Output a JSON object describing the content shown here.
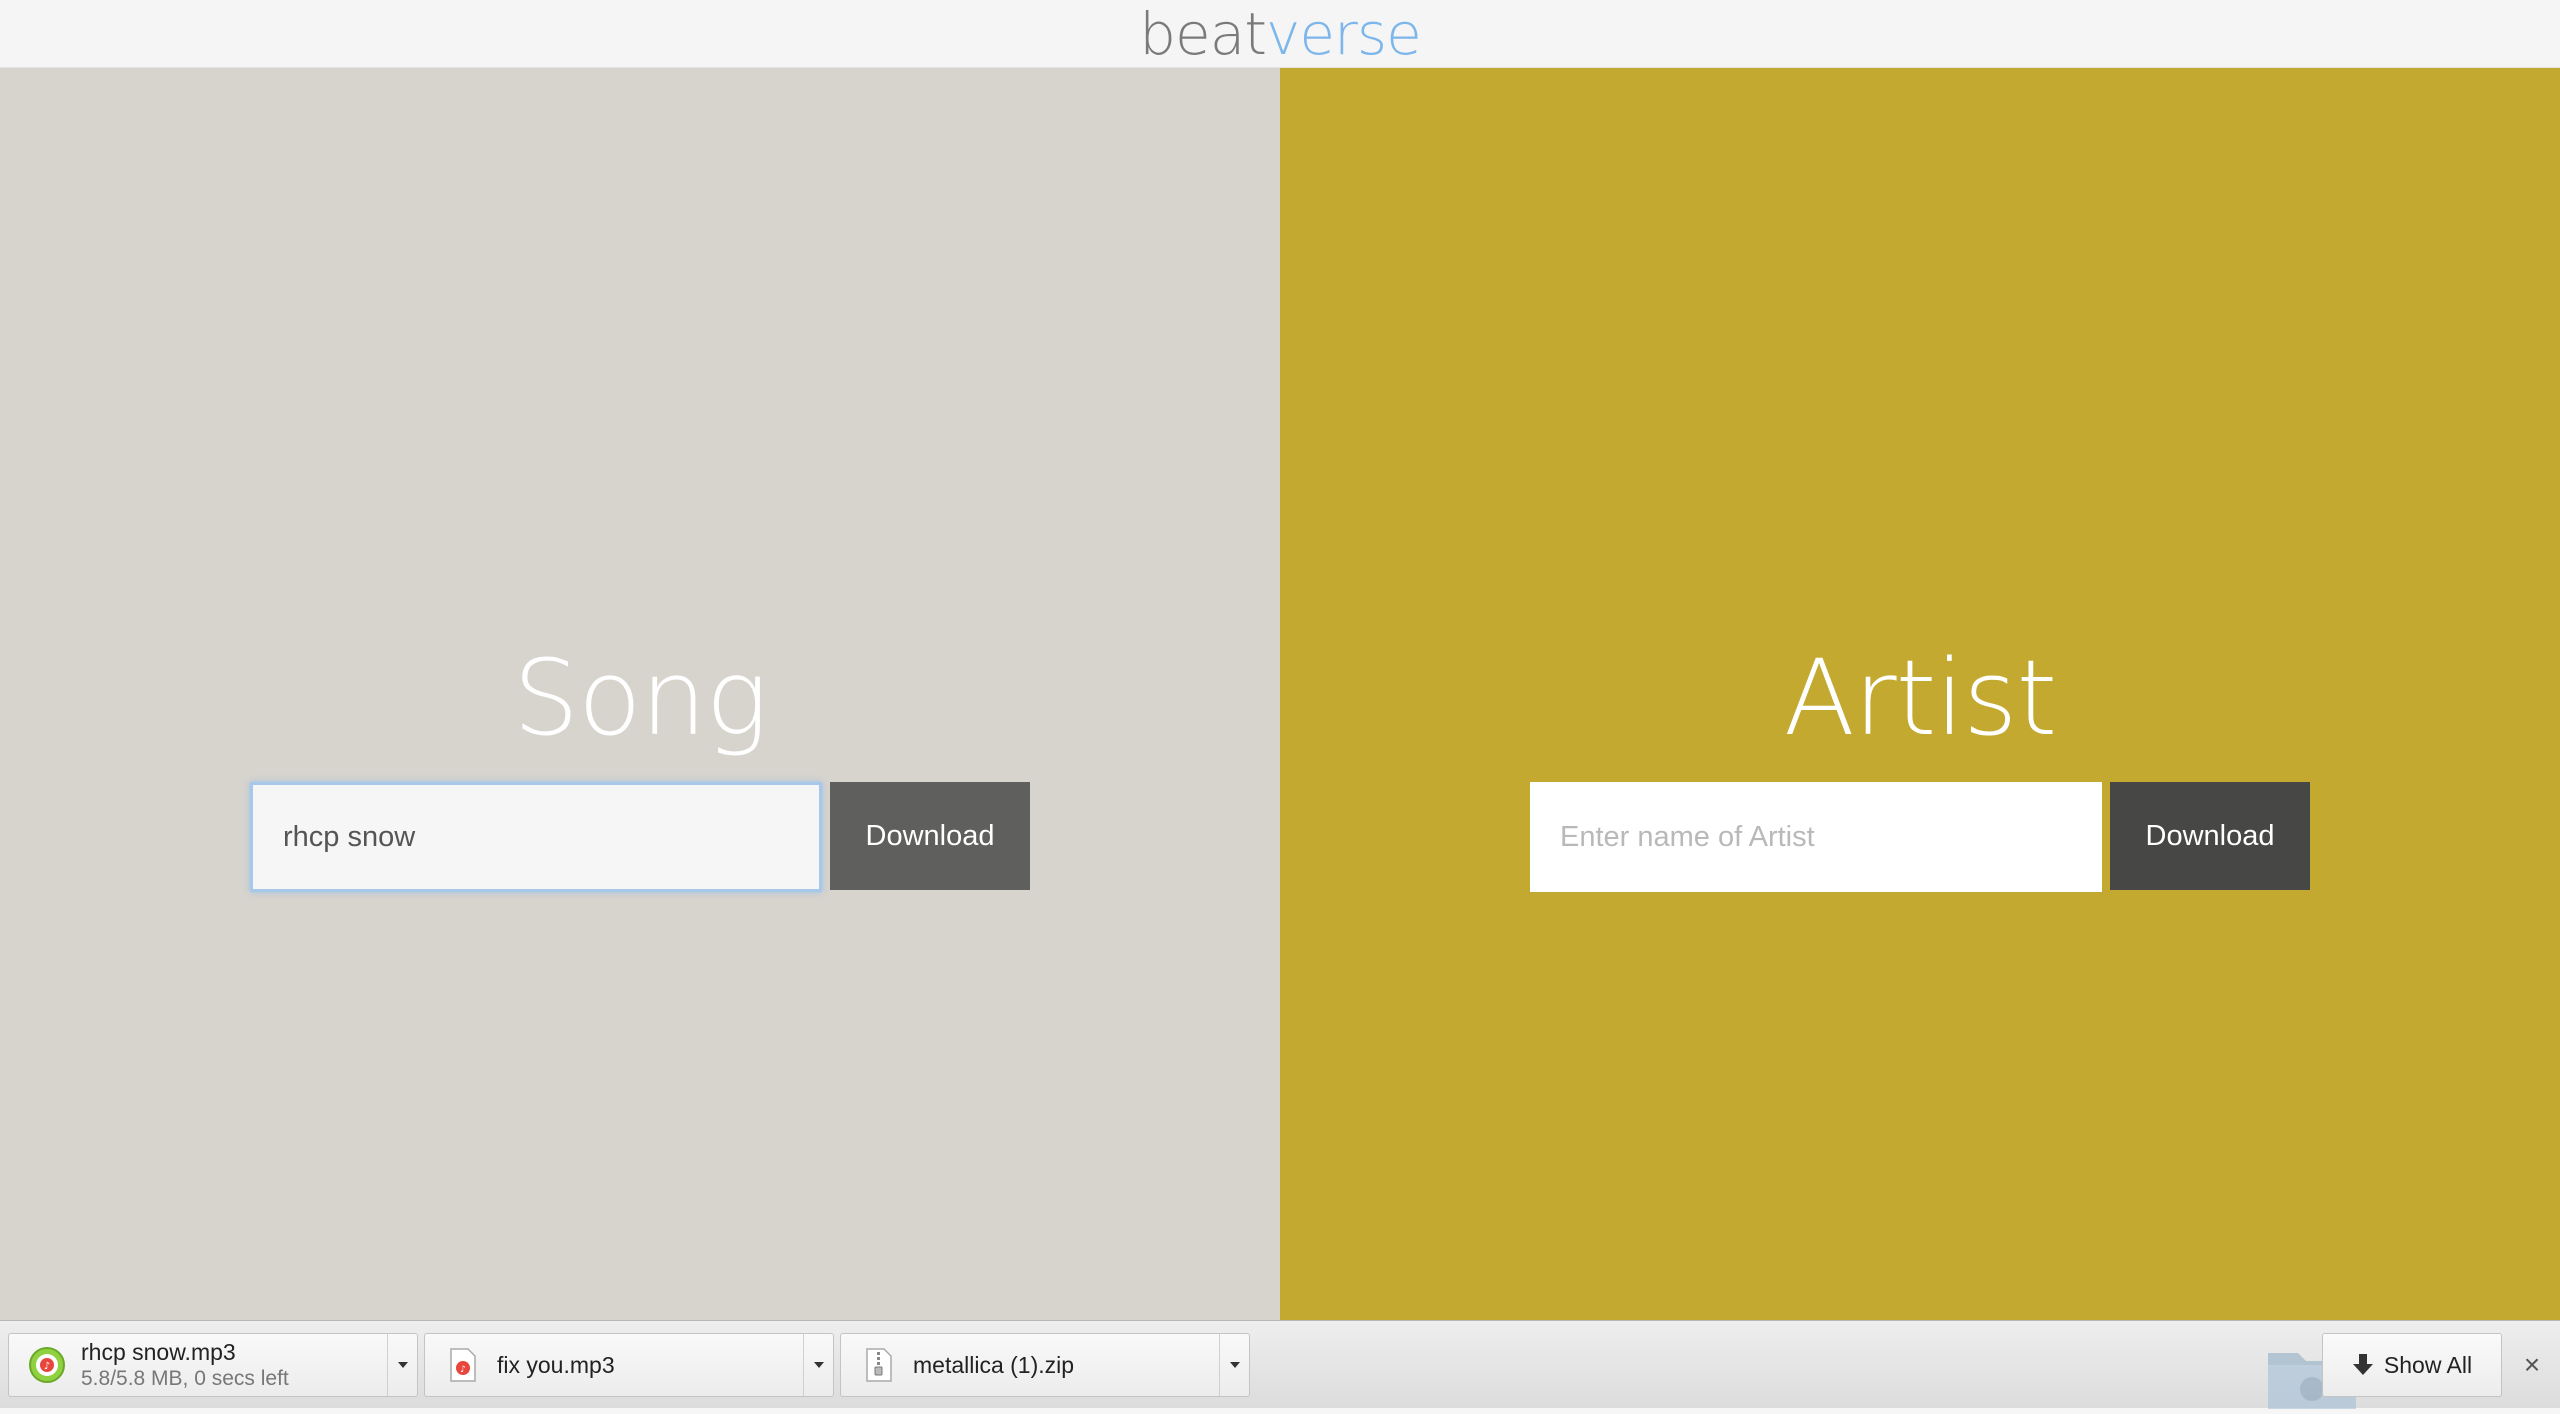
{
  "header": {
    "logo_part1": "beat",
    "logo_part2": "verse"
  },
  "song_panel": {
    "title": "Song",
    "input_value": "rhcp snow",
    "button_label": "Download"
  },
  "artist_panel": {
    "title": "Artist",
    "input_placeholder": "Enter name of Artist",
    "button_label": "Download"
  },
  "downloads_bar": {
    "items": [
      {
        "name": "rhcp snow.mp3",
        "status": "5.8/5.8 MB, 0 secs left",
        "icon": "audio-file-progress-icon",
        "progress": 1.0
      },
      {
        "name": "fix you.mp3",
        "status": "",
        "icon": "audio-file-icon"
      },
      {
        "name": "metallica (1).zip",
        "status": "",
        "icon": "zip-file-icon"
      }
    ],
    "show_all_label": "Show All",
    "close_icon": "close-icon"
  },
  "colors": {
    "logo_gray": "#7a7a7a",
    "logo_blue": "#7cb6ea",
    "song_bg": "#d7d3cd",
    "artist_bg": "#c3a92f",
    "song_button": "#5f5f5e",
    "artist_button": "#474746"
  }
}
